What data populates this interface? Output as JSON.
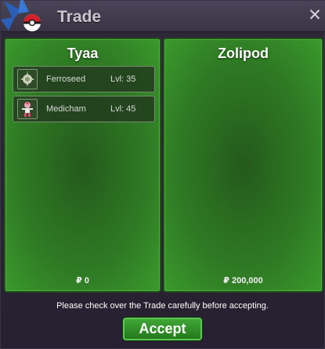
{
  "window": {
    "title": "Trade",
    "close_glyph": "✕",
    "close_icon": "close-icon",
    "logo_icon": "game-logo-icon"
  },
  "left_panel": {
    "player_name": "Tyaa",
    "money": "₽ 0",
    "items": [
      {
        "name": "Ferroseed",
        "level": "Lvl: 35",
        "sprite_icon": "ferroseed-sprite-icon"
      },
      {
        "name": "Medicham",
        "level": "Lvl: 45",
        "sprite_icon": "medicham-sprite-icon"
      }
    ]
  },
  "right_panel": {
    "player_name": "Zolipod",
    "money": "₽ 200,000",
    "items": []
  },
  "footer": {
    "notice": "Please check over the Trade carefully before accepting.",
    "accept_label": "Accept"
  },
  "colors": {
    "panel_green": "#2f7a24",
    "accent_green": "#3fa535",
    "window_bg": "#2a2534"
  }
}
